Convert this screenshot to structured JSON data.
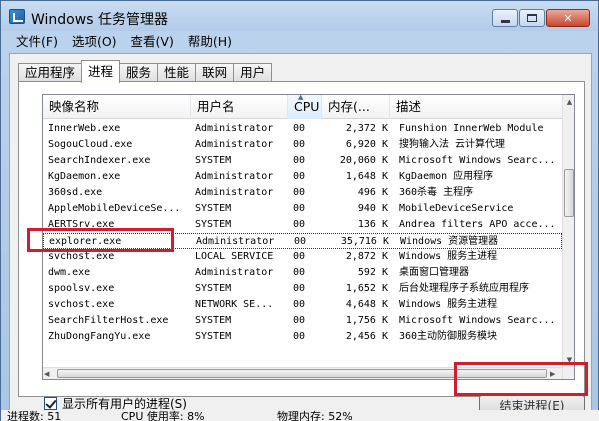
{
  "window": {
    "title": "Windows 任务管理器"
  },
  "menu": [
    "文件(F)",
    "选项(O)",
    "查看(V)",
    "帮助(H)"
  ],
  "tabs": [
    {
      "label": "应用程序",
      "active": false
    },
    {
      "label": "进程",
      "active": true
    },
    {
      "label": "服务",
      "active": false
    },
    {
      "label": "性能",
      "active": false
    },
    {
      "label": "联网",
      "active": false
    },
    {
      "label": "用户",
      "active": false
    }
  ],
  "table": {
    "columns": [
      "映像名称",
      "用户名",
      "CPU",
      "内存(...",
      "描述"
    ],
    "rows": [
      [
        "InnerWeb.exe",
        "Administrator",
        "00",
        "2,372 K",
        "Funshion InnerWeb Module"
      ],
      [
        "SogouCloud.exe",
        "Administrator",
        "00",
        "6,920 K",
        "搜狗输入法 云计算代理"
      ],
      [
        "SearchIndexer.exe",
        "SYSTEM",
        "00",
        "20,060 K",
        "Microsoft Windows Searc..."
      ],
      [
        "KgDaemon.exe",
        "Administrator",
        "00",
        "1,648 K",
        "KgDaemon 应用程序"
      ],
      [
        "360sd.exe",
        "Administrator",
        "00",
        "496 K",
        "360杀毒 主程序"
      ],
      [
        "AppleMobileDeviceSe...",
        "SYSTEM",
        "00",
        "940 K",
        "MobileDeviceService"
      ],
      [
        "AERTSrv.exe",
        "SYSTEM",
        "00",
        "136 K",
        "Andrea filters APO acce..."
      ],
      [
        "explorer.exe",
        "Administrator",
        "00",
        "35,716 K",
        "Windows 资源管理器"
      ],
      [
        "svchost.exe",
        "LOCAL SERVICE",
        "00",
        "2,872 K",
        "Windows 服务主进程"
      ],
      [
        "dwm.exe",
        "Administrator",
        "00",
        "592 K",
        "桌面窗口管理器"
      ],
      [
        "spoolsv.exe",
        "SYSTEM",
        "00",
        "1,652 K",
        "后台处理程序子系统应用程序"
      ],
      [
        "svchost.exe",
        "NETWORK SE...",
        "00",
        "4,648 K",
        "Windows 服务主进程"
      ],
      [
        "SearchFilterHost.exe",
        "SYSTEM",
        "00",
        "1,756 K",
        "Microsoft Windows Searc..."
      ],
      [
        "ZhuDongFangYu.exe",
        "SYSTEM",
        "00",
        "2,456 K",
        "360主动防御服务模块"
      ]
    ],
    "selected_row": 7
  },
  "show_all_label": "显示所有用户的进程(S)",
  "show_all_checked": true,
  "end_process_label": "结束进程(E)",
  "status": {
    "processes": "进程数: 51",
    "cpu": "CPU 使用率: 8%",
    "memory": "物理内存: 52%"
  },
  "colors": {
    "annotation": "#d11e2e",
    "titlebar": "#b3cbe8"
  }
}
